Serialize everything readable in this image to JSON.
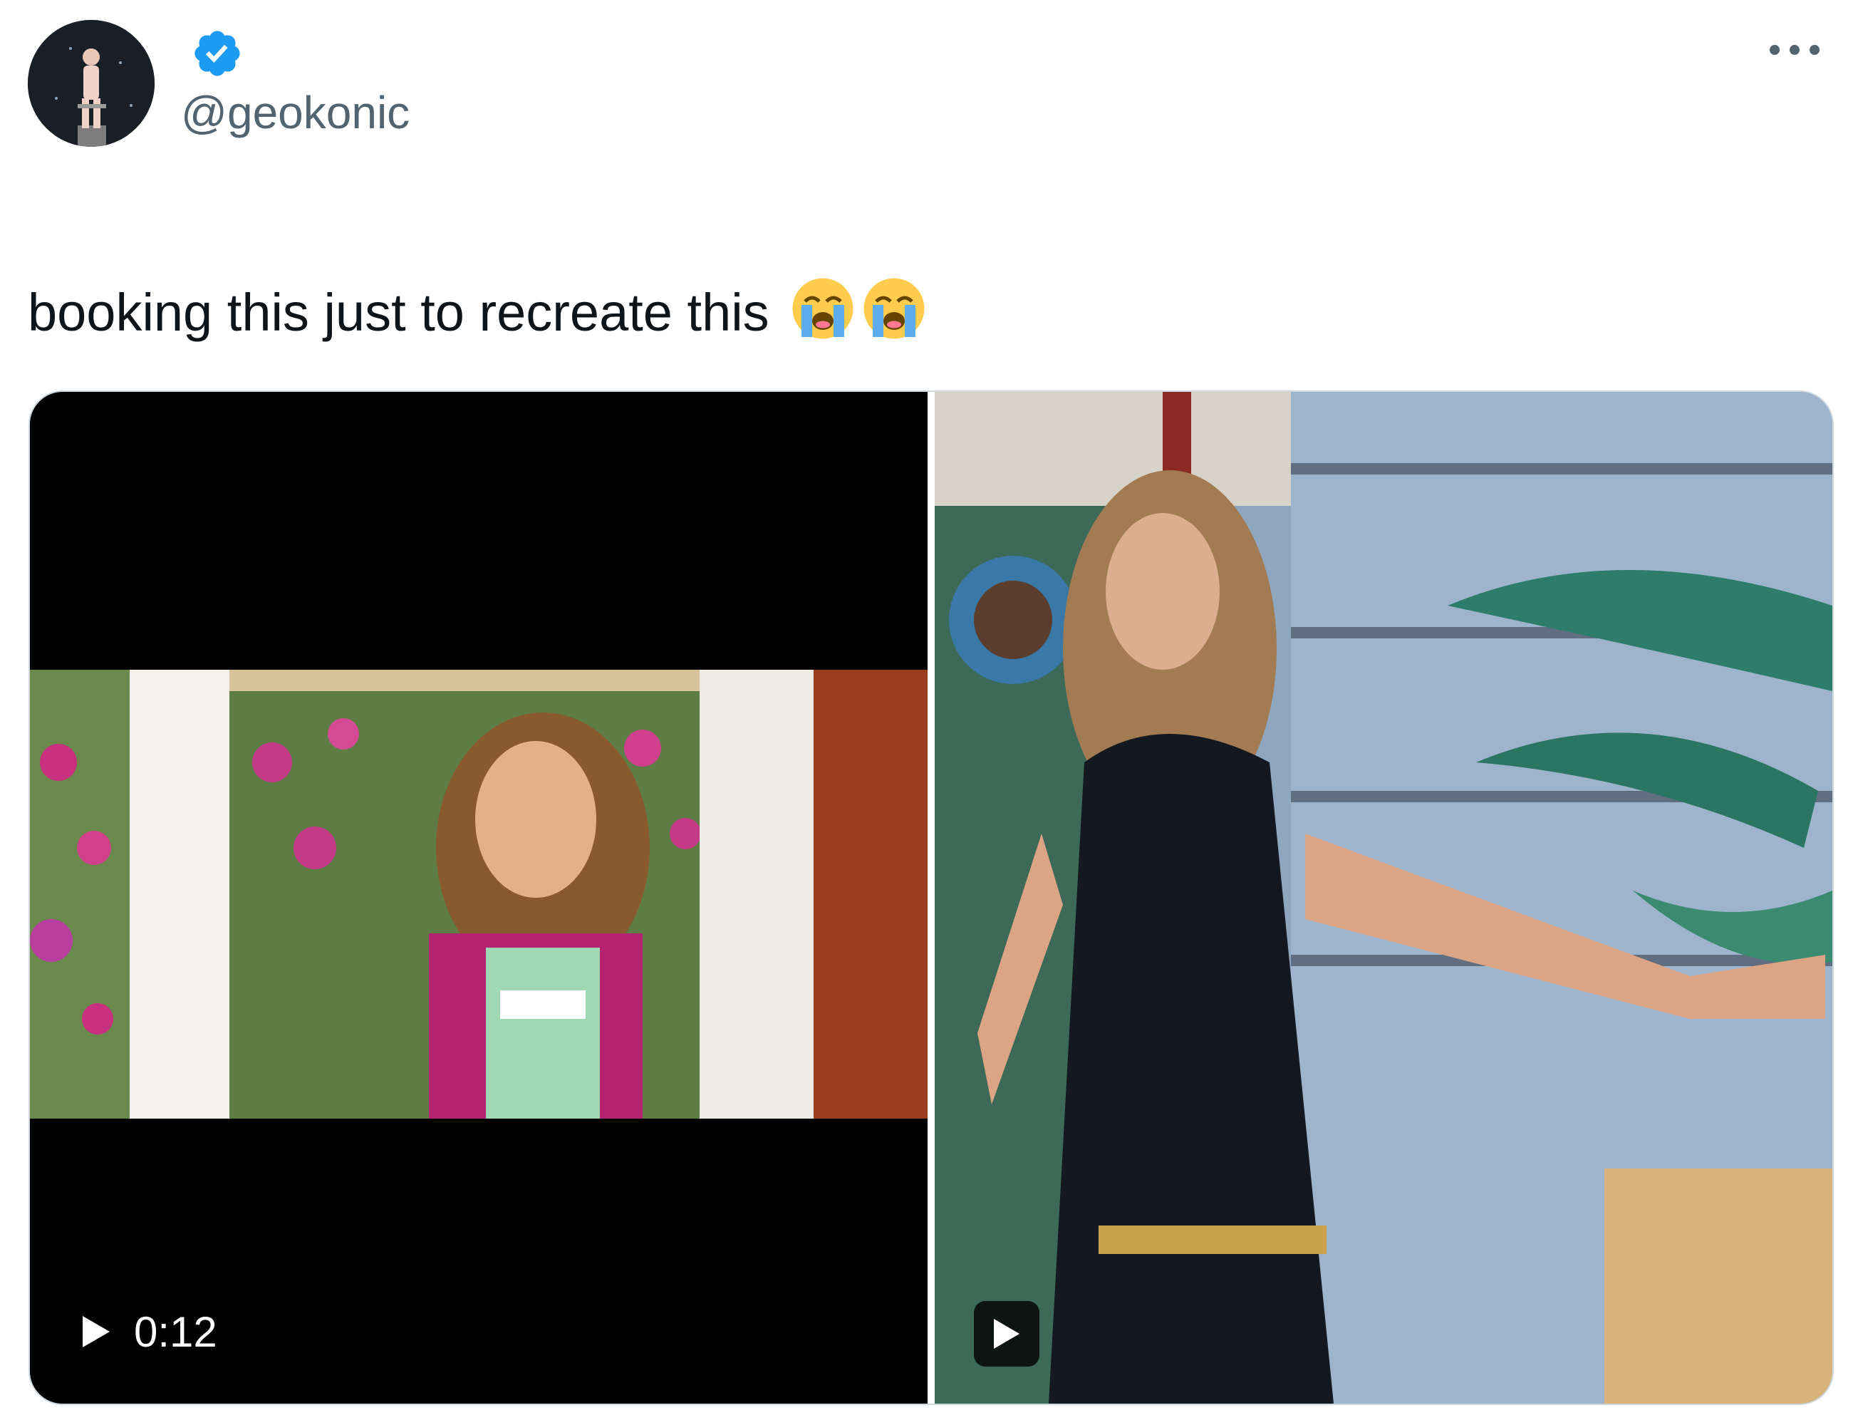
{
  "author": {
    "handle": "@geokonic",
    "verified": true,
    "avatar_icon": "avatar-image",
    "verified_icon": "verified-badge-icon",
    "verified_color": "#1d9bf0"
  },
  "actions": {
    "more_icon": "more-horizontal-icon"
  },
  "tweet": {
    "text": "booking this just to recreate this",
    "emojis": [
      "loudly-crying-face-emoji",
      "loudly-crying-face-emoji"
    ]
  },
  "media": [
    {
      "type": "video",
      "duration": "0:12",
      "play_icon": "play-icon"
    },
    {
      "type": "video",
      "play_icon": "play-icon"
    }
  ],
  "colors": {
    "text_primary": "#0f1419",
    "text_secondary": "#536471",
    "border": "#cfd9de"
  }
}
